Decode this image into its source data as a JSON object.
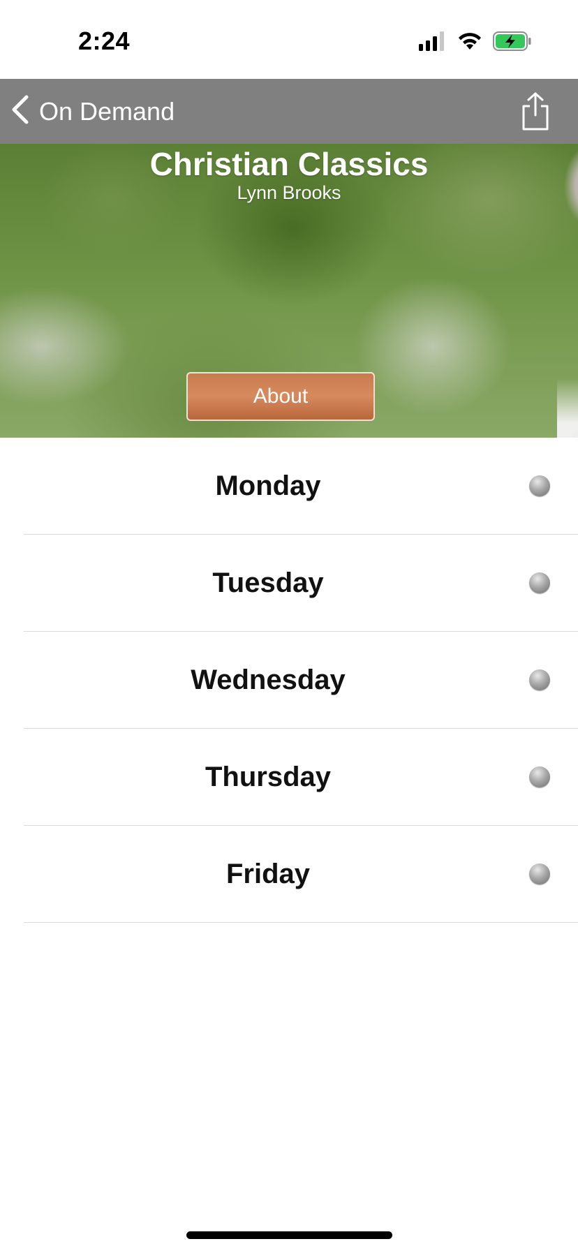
{
  "status_bar": {
    "time": "2:24",
    "signal_icon": "cellular-signal-icon",
    "wifi_icon": "wifi-icon",
    "battery_icon": "battery-charging-icon",
    "battery_color": "#34c759"
  },
  "nav_bar": {
    "back_label": "On Demand",
    "back_icon": "chevron-left-icon",
    "share_icon": "share-icon",
    "background_color": "#808080"
  },
  "hero": {
    "title": "Christian Classics",
    "host": "Lynn Brooks",
    "about_label": "About",
    "about_button_color": "#c97c4e"
  },
  "days": [
    {
      "label": "Monday",
      "status_icon": "gray-dot-icon"
    },
    {
      "label": "Tuesday",
      "status_icon": "gray-dot-icon"
    },
    {
      "label": "Wednesday",
      "status_icon": "gray-dot-icon"
    },
    {
      "label": "Thursday",
      "status_icon": "gray-dot-icon"
    },
    {
      "label": "Friday",
      "status_icon": "gray-dot-icon"
    }
  ]
}
